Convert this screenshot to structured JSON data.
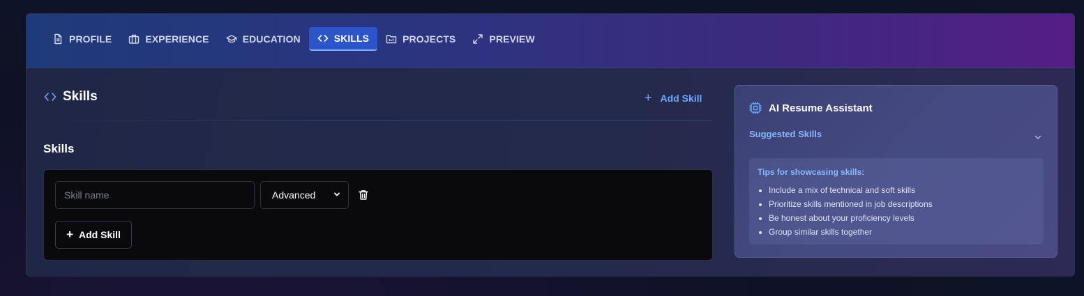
{
  "tabs": [
    {
      "label": "PROFILE",
      "icon": "document-icon",
      "active": false
    },
    {
      "label": "EXPERIENCE",
      "icon": "briefcase-icon",
      "active": false
    },
    {
      "label": "EDUCATION",
      "icon": "graduation-cap-icon",
      "active": false
    },
    {
      "label": "SKILLS",
      "icon": "code-icon",
      "active": true
    },
    {
      "label": "PROJECTS",
      "icon": "folder-icon",
      "active": false
    },
    {
      "label": "PREVIEW",
      "icon": "expand-icon",
      "active": false
    }
  ],
  "section": {
    "title": "Skills",
    "add_label": "Add Skill",
    "subtitle": "Skills"
  },
  "skill_row": {
    "name_placeholder": "Skill name",
    "name_value": "",
    "level_value": "Advanced"
  },
  "add_button_label": "Add Skill",
  "assistant": {
    "title": "AI Resume Assistant",
    "suggested_label": "Suggested Skills",
    "tips_title": "Tips for showcasing skills:",
    "tips": [
      "Include a mix of technical and soft skills",
      "Prioritize skills mentioned in job descriptions",
      "Be honest about your proficiency levels",
      "Group similar skills together"
    ]
  },
  "colors": {
    "accent": "#6fa8ff",
    "active_tab": "#2b55c9",
    "tip_title": "#8ab8ff"
  }
}
